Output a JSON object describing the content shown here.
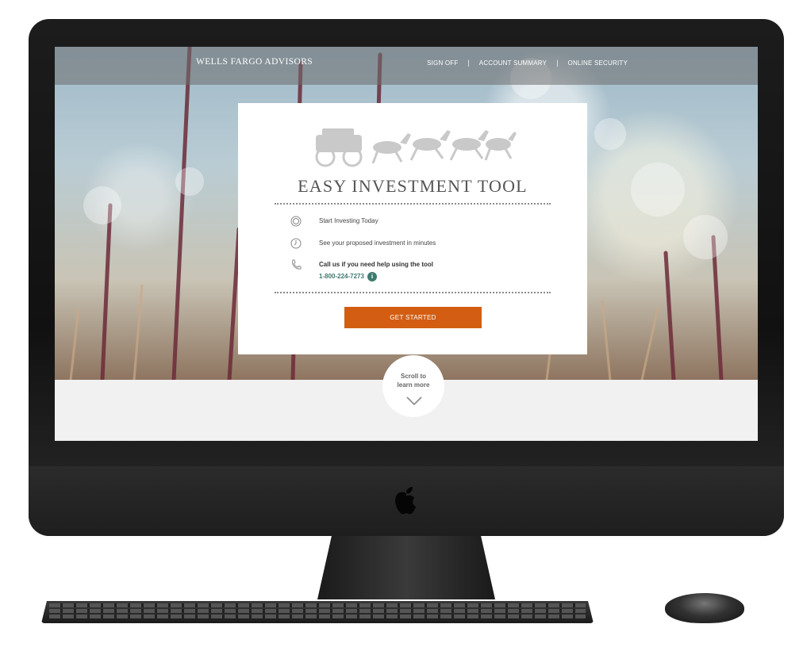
{
  "header": {
    "brand": "WELLS FARGO ADVISORS",
    "nav": [
      {
        "label": "SIGN OFF"
      },
      {
        "label": "ACCOUNT SUMMARY"
      },
      {
        "label": "ONLINE SECURITY"
      }
    ],
    "separator": "|"
  },
  "card": {
    "title": "EASY INVESTMENT TOOL",
    "features": [
      {
        "icon": "target-icon",
        "text": "Start Investing Today"
      },
      {
        "icon": "clock-icon",
        "text": "See your proposed investment in minutes"
      },
      {
        "icon": "phone-icon",
        "text": "Call us if you need help using the tool",
        "phone": "1-800-224-7273",
        "info": "i"
      }
    ],
    "cta_label": "GET STARTED"
  },
  "scroll_prompt": "Scroll to learn more",
  "colors": {
    "accent": "#d25d13",
    "phone": "#3e7a6f",
    "topbar": "#6e6e6e"
  }
}
